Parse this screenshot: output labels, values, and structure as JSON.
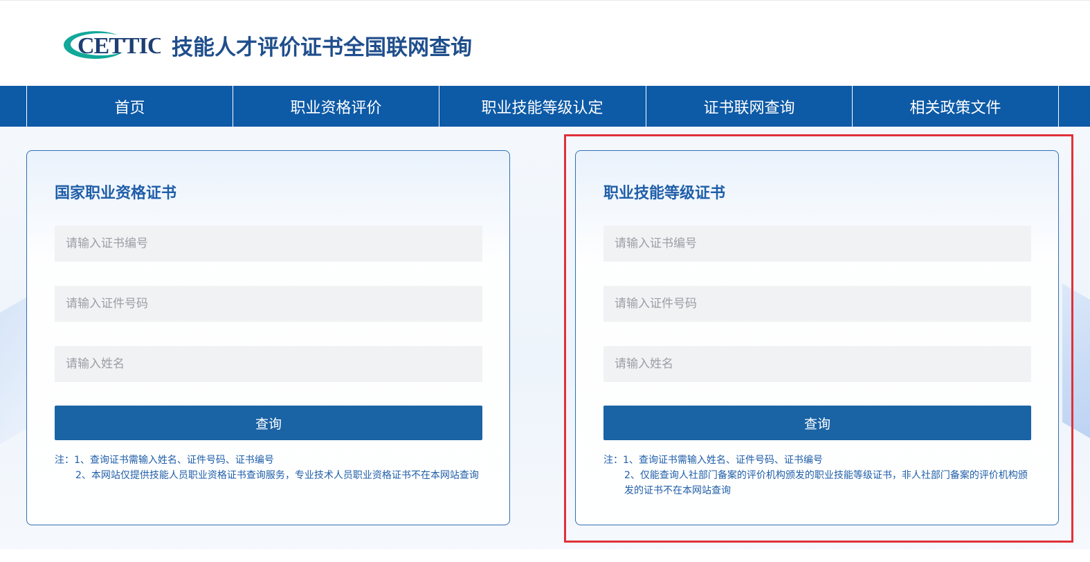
{
  "header": {
    "logo_text": "CETTIC",
    "title": "技能人才评价证书全国联网查询"
  },
  "nav": {
    "items": [
      {
        "label": "首页"
      },
      {
        "label": "职业资格评价"
      },
      {
        "label": "职业技能等级认定"
      },
      {
        "label": "证书联网查询"
      },
      {
        "label": "相关政策文件"
      }
    ]
  },
  "cards": [
    {
      "title": "国家职业资格证书",
      "cert_no_placeholder": "请输入证书编号",
      "id_no_placeholder": "请输入证件号码",
      "name_placeholder": "请输入姓名",
      "button_label": "查询",
      "note_1": "注：1、查询证书需输入姓名、证件号码、证书编号",
      "note_2": "2、本网站仅提供技能人员职业资格证书查询服务，专业技术人员职业资格证书不在本网站查询"
    },
    {
      "title": "职业技能等级证书",
      "cert_no_placeholder": "请输入证书编号",
      "id_no_placeholder": "请输入证件号码",
      "name_placeholder": "请输入姓名",
      "button_label": "查询",
      "note_1": "注：1、查询证书需输入姓名、证件号码、证书编号",
      "note_2": "2、仅能查询人社部门备案的评价机构颁发的职业技能等级证书，非人社部门备案的评价机构颁发的证书不在本网站查询"
    }
  ],
  "colors": {
    "nav_bg": "#0d5aa6",
    "title_blue": "#1f4e8c",
    "button_bg": "#1a63a5",
    "highlight_red": "#e0303a"
  }
}
